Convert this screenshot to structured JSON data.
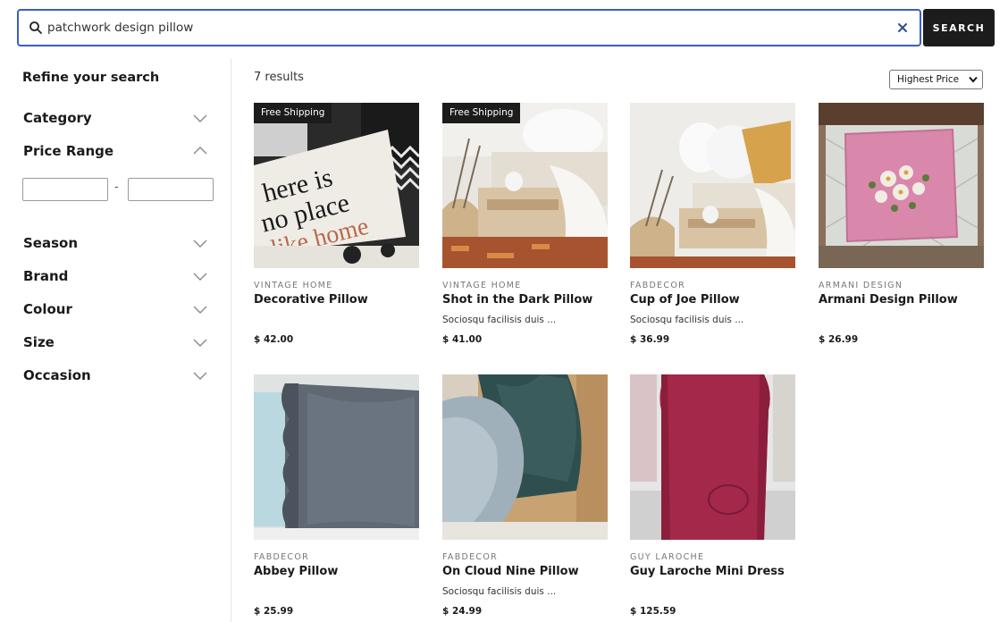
{
  "search": {
    "query": "patchwork design pillow",
    "button_label": "SEARCH"
  },
  "sidebar": {
    "title": "Refine your search",
    "facets": [
      {
        "label": "Category",
        "expanded": false
      },
      {
        "label": "Price Range",
        "expanded": true
      },
      {
        "label": "Season",
        "expanded": false
      },
      {
        "label": "Brand",
        "expanded": false
      },
      {
        "label": "Colour",
        "expanded": false
      },
      {
        "label": "Size",
        "expanded": false
      },
      {
        "label": "Occasion",
        "expanded": false
      }
    ],
    "price_min": "",
    "price_max": "",
    "price_separator": "-"
  },
  "results": {
    "count_label": "7 results",
    "sort_value": "Highest Price",
    "products": [
      {
        "badge": "Free Shipping",
        "brand": "VINTAGE HOME",
        "name": "Decorative Pillow",
        "description": "",
        "price": "$ 42.00"
      },
      {
        "badge": "Free Shipping",
        "brand": "VINTAGE HOME",
        "name": "Shot in the Dark Pillow",
        "description": "Sociosqu facilisis duis ...",
        "price": "$ 41.00"
      },
      {
        "badge": "",
        "brand": "FABDECOR",
        "name": "Cup of Joe Pillow",
        "description": "Sociosqu facilisis duis ...",
        "price": "$ 36.99"
      },
      {
        "badge": "",
        "brand": "ARMANI DESIGN",
        "name": "Armani Design Pillow",
        "description": "",
        "price": "$ 26.99"
      },
      {
        "badge": "",
        "brand": "FABDECOR",
        "name": "Abbey Pillow",
        "description": "",
        "price": "$ 25.99"
      },
      {
        "badge": "",
        "brand": "FABDECOR",
        "name": "On Cloud Nine Pillow",
        "description": "Sociosqu facilisis duis ...",
        "price": "$ 24.99"
      },
      {
        "badge": "",
        "brand": "GUY LAROCHE",
        "name": "Guy Laroche Mini Dress",
        "description": "",
        "price": "$ 125.59"
      }
    ]
  },
  "images": {
    "p1_text_lines": [
      "here is",
      "no place",
      "like home"
    ]
  },
  "colors": {
    "search_border": "#3a5fc0",
    "button_bg": "#1c1c1c",
    "badge_bg": "#1c1c1c"
  }
}
